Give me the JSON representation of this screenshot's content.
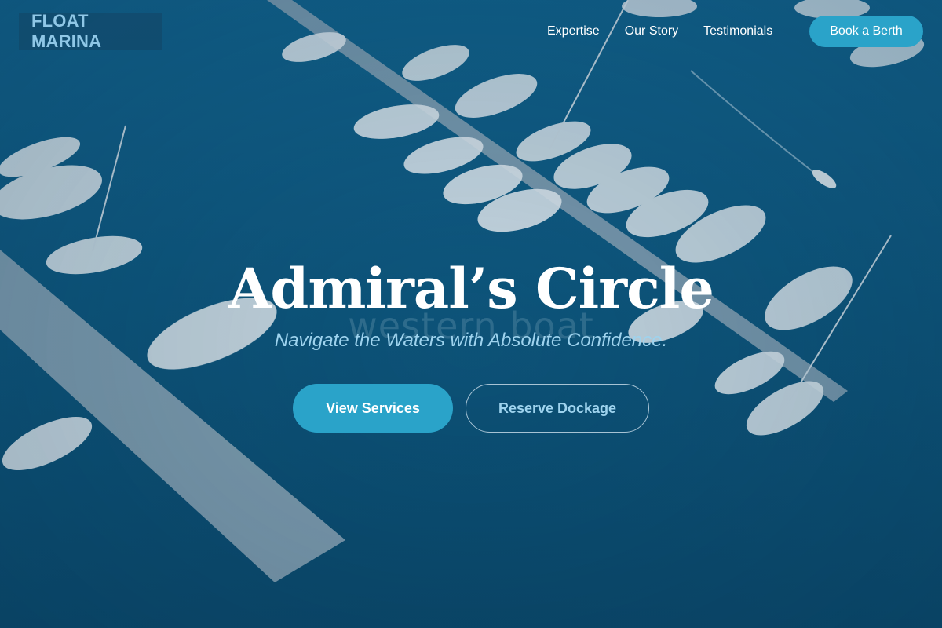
{
  "brand": {
    "name": "FLOAT MARINA"
  },
  "nav": {
    "links": [
      "Expertise",
      "Our Story",
      "Testimonials"
    ],
    "cta": "Book a Berth"
  },
  "hero": {
    "title": "Admiral’s Circle",
    "ghost_text": "western boat",
    "subtitle": "Navigate the Waters with Absolute Confidence.",
    "primary_button": "View Services",
    "secondary_button": "Reserve Dockage"
  },
  "colors": {
    "accent": "#2aa3c9",
    "water": "#0c5278",
    "subtitle": "#9ed3ee",
    "brand_text": "#8fc7e6"
  }
}
